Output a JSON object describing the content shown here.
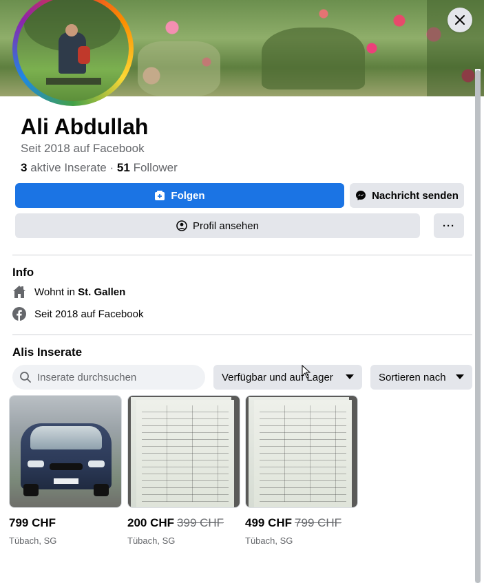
{
  "profile": {
    "name": "Ali Abdullah",
    "since": "Seit 2018 auf Facebook",
    "active_count": "3",
    "active_label": "aktive Inserate",
    "separator": "·",
    "follower_count": "51",
    "follower_label": "Follower"
  },
  "actions": {
    "follow": "Folgen",
    "message": "Nachricht senden",
    "view_profile": "Profil ansehen",
    "more": "···"
  },
  "info": {
    "title": "Info",
    "lives_prefix": "Wohnt in",
    "lives_city": "St. Gallen",
    "since": "Seit 2018 auf Facebook"
  },
  "listings": {
    "title": "Alis Inserate",
    "search_placeholder": "Inserate durchsuchen",
    "filter_availability": "Verfügbar und auf Lager",
    "filter_sort": "Sortieren nach",
    "items": [
      {
        "price": "799 CHF",
        "old_price": "",
        "location": "Tübach, SG"
      },
      {
        "price": "200 CHF",
        "old_price": "399 CHF",
        "location": "Tübach, SG"
      },
      {
        "price": "499 CHF",
        "old_price": "799 CHF",
        "location": "Tübach, SG"
      }
    ]
  },
  "colors": {
    "primary": "#1b74e4",
    "secondary_button": "#e4e6eb",
    "muted_text": "#65676b"
  },
  "icons": [
    "close-icon",
    "follow-icon",
    "messenger-icon",
    "profile-icon",
    "more-icon",
    "home-icon",
    "facebook-icon",
    "search-icon",
    "caret-down-icon"
  ]
}
